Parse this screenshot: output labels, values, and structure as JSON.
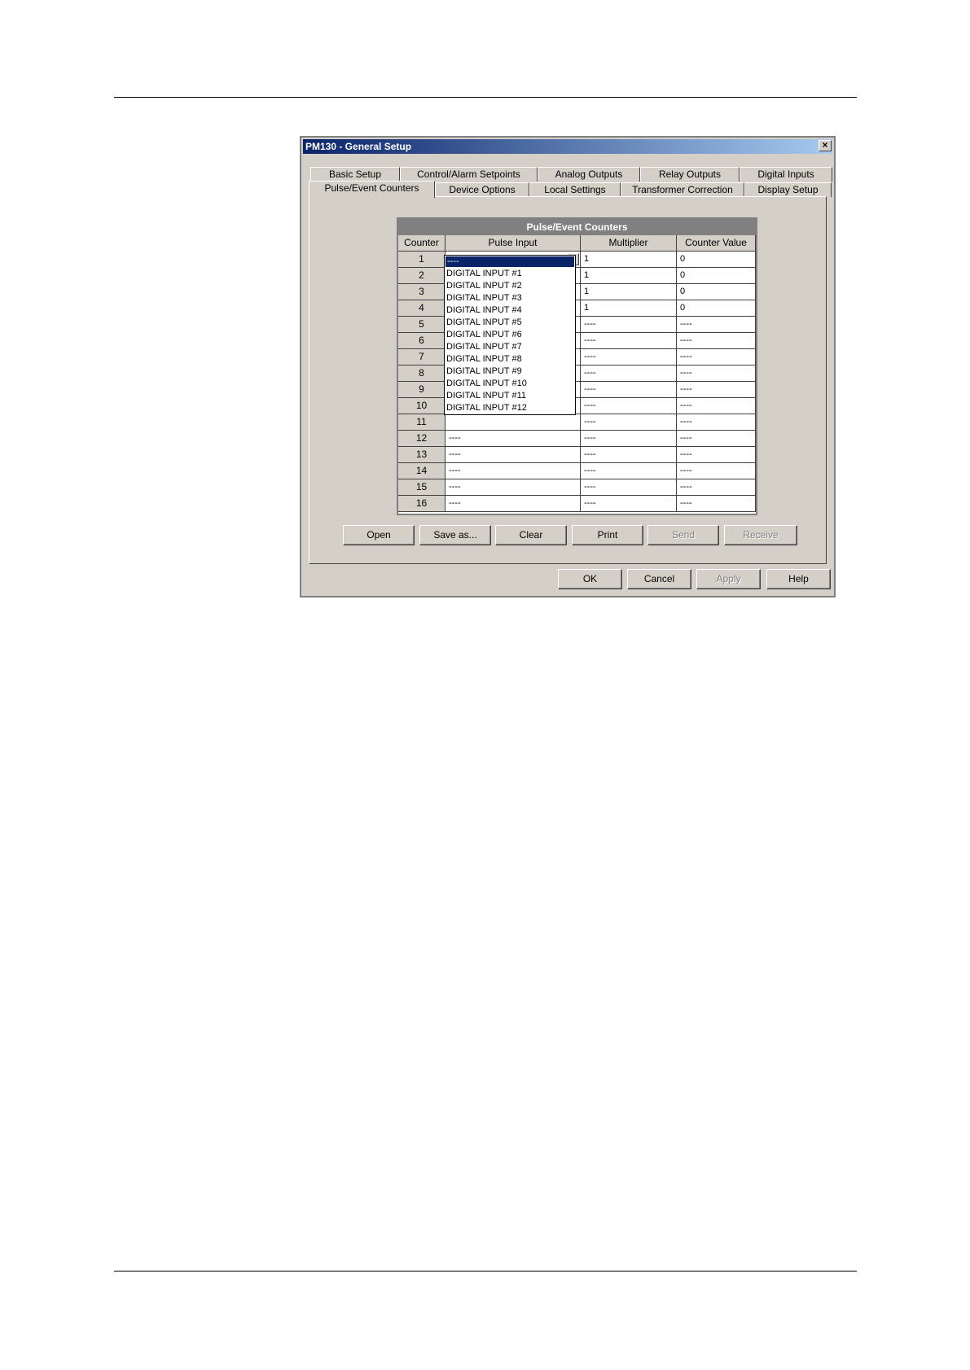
{
  "dialog": {
    "title": "PM130 - General Setup",
    "close_label": "×"
  },
  "tabs_row1": [
    "Basic Setup",
    "Control/Alarm Setpoints",
    "Analog Outputs",
    "Relay Outputs",
    "Digital Inputs"
  ],
  "tabs_row2": [
    "Pulse/Event Counters",
    "Device Options",
    "Local Settings",
    "Transformer Correction",
    "Display Setup"
  ],
  "active_tab": "Pulse/Event Counters",
  "grid": {
    "title": "Pulse/Event Counters",
    "columns": [
      "Counter",
      "Pulse Input",
      "Multiplier",
      "Counter Value"
    ],
    "rows": [
      [
        "1",
        "----",
        "1",
        "0"
      ],
      [
        "2",
        "",
        "1",
        "0"
      ],
      [
        "3",
        "",
        "1",
        "0"
      ],
      [
        "4",
        "",
        "1",
        "0"
      ],
      [
        "5",
        "",
        "----",
        "----"
      ],
      [
        "6",
        "",
        "----",
        "----"
      ],
      [
        "7",
        "",
        "----",
        "----"
      ],
      [
        "8",
        "",
        "----",
        "----"
      ],
      [
        "9",
        "",
        "----",
        "----"
      ],
      [
        "10",
        "",
        "----",
        "----"
      ],
      [
        "11",
        "",
        "----",
        "----"
      ],
      [
        "12",
        "----",
        "----",
        "----"
      ],
      [
        "13",
        "----",
        "----",
        "----"
      ],
      [
        "14",
        "----",
        "----",
        "----"
      ],
      [
        "15",
        "----",
        "----",
        "----"
      ],
      [
        "16",
        "----",
        "----",
        "----"
      ]
    ]
  },
  "dropdown": {
    "selected": "----",
    "options": [
      "----",
      "DIGITAL INPUT #1",
      "DIGITAL INPUT #2",
      "DIGITAL INPUT #3",
      "DIGITAL INPUT #4",
      "DIGITAL INPUT #5",
      "DIGITAL INPUT #6",
      "DIGITAL INPUT #7",
      "DIGITAL INPUT #8",
      "DIGITAL INPUT #9",
      "DIGITAL INPUT #10",
      "DIGITAL INPUT #11",
      "DIGITAL INPUT #12"
    ]
  },
  "panel_buttons": [
    {
      "label": "Open",
      "enabled": true
    },
    {
      "label": "Save as...",
      "enabled": true
    },
    {
      "label": "Clear",
      "enabled": true
    },
    {
      "label": "Print",
      "enabled": true
    },
    {
      "label": "Send",
      "enabled": false
    },
    {
      "label": "Receive",
      "enabled": false
    }
  ],
  "dialog_buttons": [
    {
      "label": "OK",
      "enabled": true
    },
    {
      "label": "Cancel",
      "enabled": true
    },
    {
      "label": "Apply",
      "enabled": false
    },
    {
      "label": "Help",
      "enabled": true
    }
  ],
  "icons": {
    "combo_arrow": "chevron-down-icon",
    "close": "close-icon"
  },
  "colors": {
    "titlebar": "#0a246a",
    "face": "#d4d0c8",
    "selection": "#0a246a",
    "grid_header": "#808080"
  }
}
